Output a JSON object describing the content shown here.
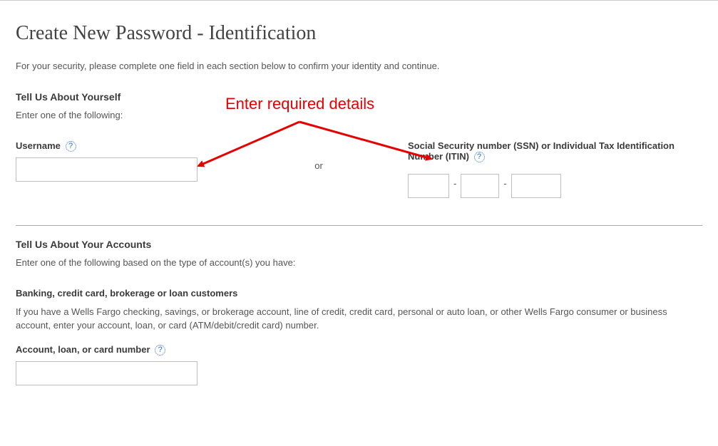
{
  "page": {
    "title": "Create New Password - Identification",
    "intro": "For your security, please complete one field in each section below to confirm your identity and continue."
  },
  "section1": {
    "title": "Tell Us About Yourself",
    "sub": "Enter one of the following:",
    "username_label": "Username",
    "or_text": "or",
    "ssn_label": "Social Security number (SSN) or Individual Tax Identification Number (ITIN)",
    "ssn_dash": "-",
    "username_value": "",
    "ssn_a": "",
    "ssn_b": "",
    "ssn_c": ""
  },
  "section2": {
    "title": "Tell Us About Your Accounts",
    "sub": "Enter one of the following based on the type of account(s) you have:",
    "group1_title": "Banking, credit card, brokerage or loan customers",
    "group1_body": "If you have a Wells Fargo checking, savings, or brokerage account, line of credit, credit card, personal or auto loan, or other Wells Fargo consumer or business account, enter your account, loan, or card (ATM/debit/credit card) number.",
    "account_label": "Account, loan, or card number",
    "account_value": ""
  },
  "help_glyph": "?",
  "annotation": {
    "text": "Enter required details"
  }
}
